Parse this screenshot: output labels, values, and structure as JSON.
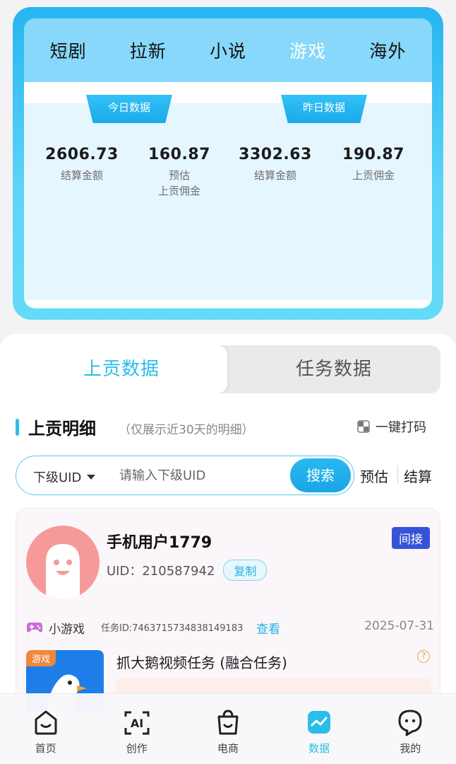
{
  "category_tabs": [
    "短剧",
    "拉新",
    "小说",
    "游戏",
    "海外"
  ],
  "active_category": "游戏",
  "today": {
    "label": "今日数据",
    "settle_amount": "2606.73",
    "settle_label": "结算金额",
    "est_commission": "160.87",
    "est_label_1": "预估",
    "est_label_2": "上贡佣金"
  },
  "yesterday": {
    "label": "昨日数据",
    "settle_amount": "3302.63",
    "settle_label": "结算金额",
    "commission": "190.87",
    "commission_label": "上贡佣金"
  },
  "segment": {
    "active": "上贡数据",
    "inactive": "任务数据"
  },
  "section": {
    "title": "上贡明细",
    "subtitle": "（仅展示近30天的明细）",
    "mask_button": "一键打码"
  },
  "search": {
    "selector": "下级UID",
    "placeholder": "请输入下级UID",
    "button": "搜索",
    "mode_estimate": "预估",
    "mode_settle": "结算"
  },
  "record": {
    "user_name": "手机用户1779",
    "uid_label": "UID：",
    "uid_value": "210587942",
    "copy_label": "复制",
    "relation_tag": "间接",
    "game_type": "小游戏",
    "task_id": "任务ID:7463715734838149183",
    "view_label": "查看",
    "date": "2025-07-31",
    "thumb_tag": "游戏",
    "task_title": "抓大鹅视频任务 (融合任务)",
    "help_icon": "?"
  },
  "tabbar": [
    {
      "label": "首页",
      "icon": "home-icon"
    },
    {
      "label": "创作",
      "icon": "ai-icon"
    },
    {
      "label": "电商",
      "icon": "shopping-bag-icon"
    },
    {
      "label": "数据",
      "icon": "chart-icon",
      "active": true
    },
    {
      "label": "我的",
      "icon": "profile-icon"
    }
  ],
  "colors": {
    "accent": "#2bbde9",
    "indirect_tag": "#3652d9",
    "avatar": "#f59a98"
  }
}
